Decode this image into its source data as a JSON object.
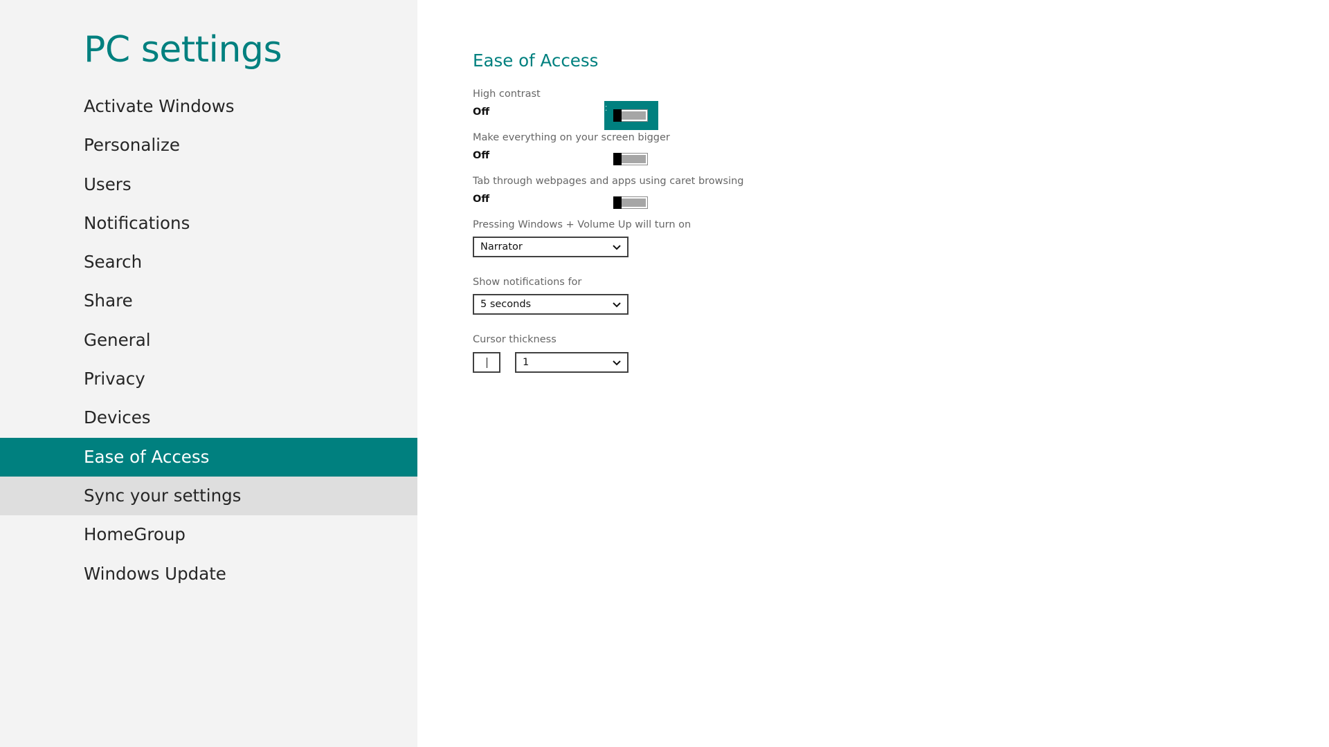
{
  "sidebar": {
    "title": "PC settings",
    "items": [
      {
        "label": "Activate Windows"
      },
      {
        "label": "Personalize"
      },
      {
        "label": "Users"
      },
      {
        "label": "Notifications"
      },
      {
        "label": "Search"
      },
      {
        "label": "Share"
      },
      {
        "label": "General"
      },
      {
        "label": "Privacy"
      },
      {
        "label": "Devices"
      },
      {
        "label": "Ease of Access"
      },
      {
        "label": "Sync your settings"
      },
      {
        "label": "HomeGroup"
      },
      {
        "label": "Windows Update"
      }
    ],
    "selected": "Ease of Access",
    "hovered": "Sync your settings"
  },
  "main": {
    "section_title": "Ease of Access",
    "high_contrast": {
      "label": "High contrast",
      "state": "Off"
    },
    "bigger": {
      "label": "Make everything on your screen bigger",
      "state": "Off"
    },
    "caret_browsing": {
      "label": "Tab through webpages and apps using caret browsing",
      "state": "Off"
    },
    "volume_up": {
      "label": "Pressing Windows + Volume Up will turn on",
      "value": "Narrator"
    },
    "notifications": {
      "label": "Show notifications for",
      "value": "5 seconds"
    },
    "cursor": {
      "label": "Cursor thickness",
      "value": "1"
    }
  },
  "colors": {
    "accent": "#00807f",
    "sidebar_bg": "#f3f3f3",
    "hover_bg": "#dedede"
  },
  "icons": {
    "dropdown": "chevron-down-icon"
  }
}
